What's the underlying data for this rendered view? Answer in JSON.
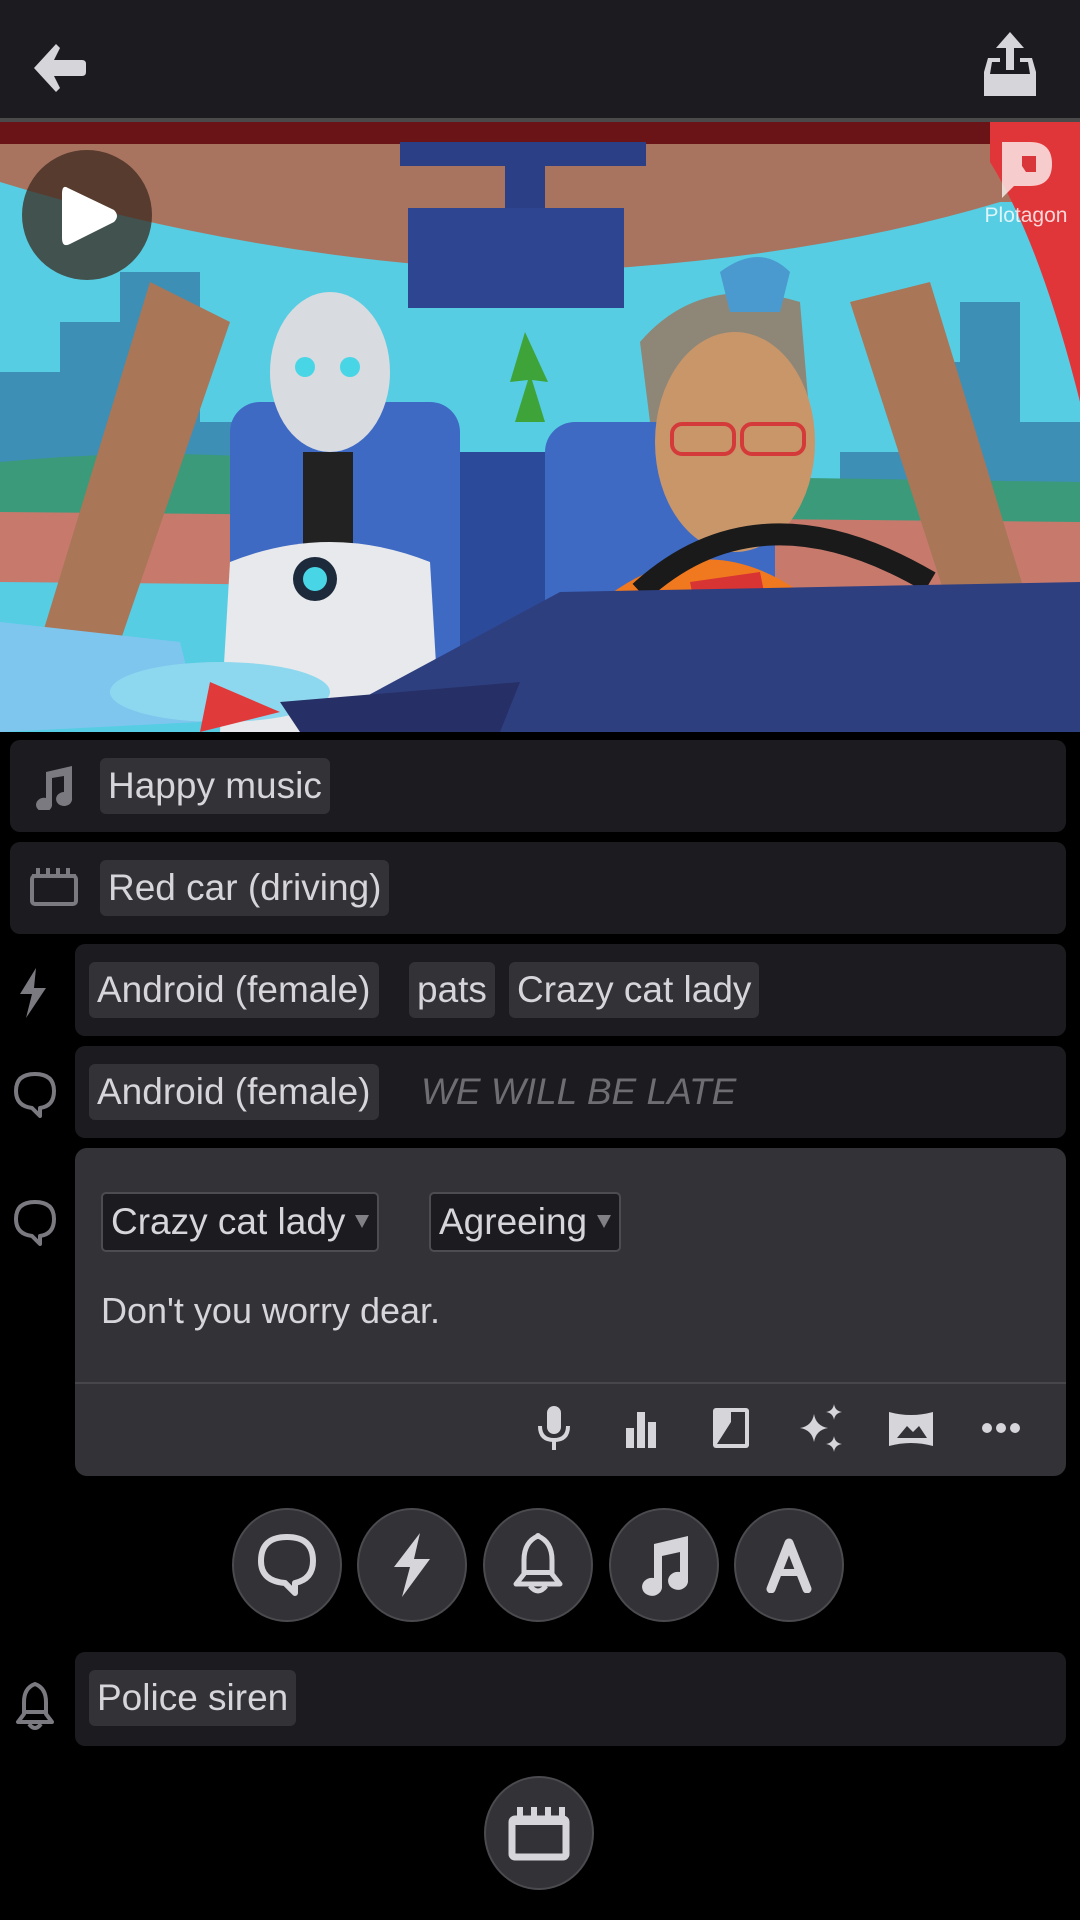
{
  "topbar": {
    "back_icon": "arrow-left-icon",
    "share_icon": "export-upload-icon"
  },
  "video": {
    "play_icon": "play-icon",
    "watermark_text": "Plotagon",
    "scene_description": "Android (female) and Crazy cat lady riding in a red car"
  },
  "timeline": {
    "music": {
      "icon": "music-note-icon",
      "label": "Happy music"
    },
    "scene": {
      "icon": "clapperboard-icon",
      "label": "Red car (driving)"
    },
    "action": {
      "icon": "lightning-icon",
      "actor": "Android (female)",
      "verb": "pats",
      "target": "Crazy cat lady"
    },
    "dialogue1": {
      "icon": "speech-bubble-icon",
      "actor": "Android (female)",
      "text": "WE WILL BE LATE"
    },
    "dialogue2": {
      "icon": "speech-bubble-icon",
      "actor_select": "Crazy cat lady",
      "emotion_select": "Agreeing",
      "text": "Don't you worry dear.",
      "tools": [
        "microphone-icon",
        "bar-chart-icon",
        "camera-angle-icon",
        "sparkles-icon",
        "panorama-icon",
        "more-icon"
      ]
    },
    "add_buttons": [
      "add-dialogue",
      "add-action",
      "add-sound-effect",
      "add-music",
      "add-text"
    ],
    "sound": {
      "icon": "bell-icon",
      "label": "Police siren"
    },
    "add_scene_button": "add-scene"
  }
}
